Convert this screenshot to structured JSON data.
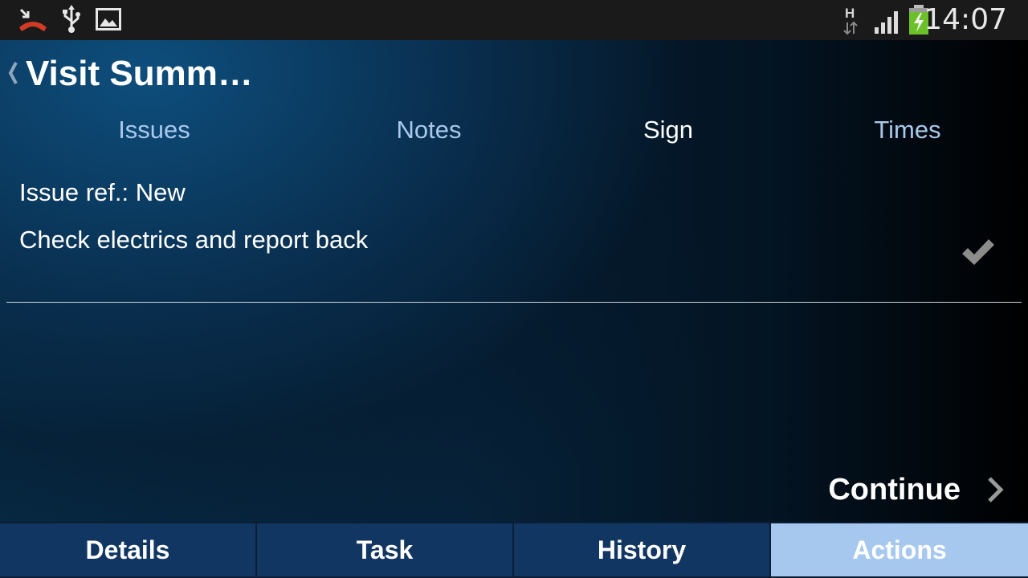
{
  "status_bar": {
    "left_icons": [
      "missed-call-icon",
      "usb-icon",
      "image-icon"
    ],
    "right_icons": [
      "h-network-icon",
      "signal-icon",
      "battery-charging-icon"
    ],
    "time": "14:07"
  },
  "header": {
    "title": "Visit Summ…"
  },
  "tabs": [
    {
      "label": "Issues",
      "active": false
    },
    {
      "label": "Notes",
      "active": false
    },
    {
      "label": "Sign",
      "active": true
    },
    {
      "label": "Times",
      "active": false
    }
  ],
  "issue": {
    "ref": "Issue ref.: New",
    "description": "Check electrics and report back"
  },
  "continue_label": "Continue",
  "bottom_nav": [
    {
      "label": "Details",
      "active": false
    },
    {
      "label": "Task",
      "active": false
    },
    {
      "label": "History",
      "active": false
    },
    {
      "label": "Actions",
      "active": true
    }
  ],
  "colors": {
    "tab_inactive": "#a8c8ec",
    "nav_button": "#123662",
    "nav_active": "#a7c8ee",
    "missed_call_red": "#d23a26",
    "battery_green": "#6cc02a"
  }
}
